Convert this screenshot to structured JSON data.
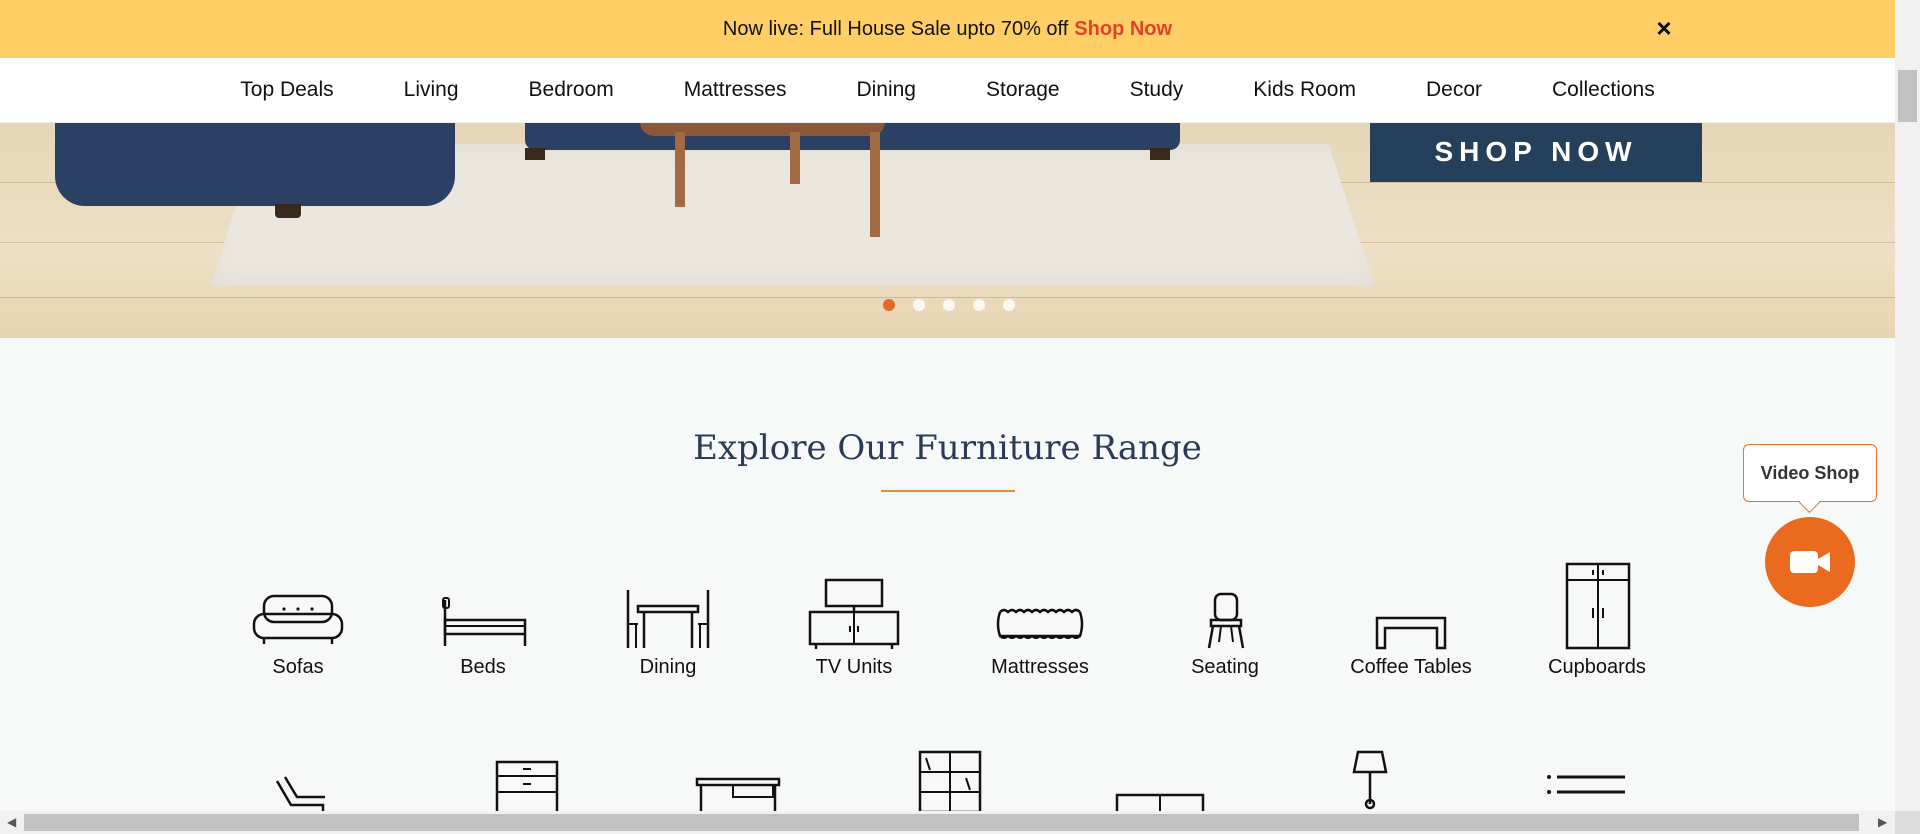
{
  "announcement": {
    "text": "Now live: Full House Sale upto 70% off",
    "link": "Shop Now",
    "close": "×"
  },
  "nav": {
    "items": [
      "Top Deals",
      "Living",
      "Bedroom",
      "Mattresses",
      "Dining",
      "Storage",
      "Study",
      "Kids Room",
      "Decor",
      "Collections"
    ]
  },
  "hero": {
    "cta": "SHOP NOW",
    "slides": 5,
    "active_slide": 1
  },
  "explore": {
    "title": "Explore Our Furniture Range",
    "categories": [
      {
        "label": "Sofas",
        "icon": "sofa-icon"
      },
      {
        "label": "Beds",
        "icon": "bed-icon"
      },
      {
        "label": "Dining",
        "icon": "dining-table-icon"
      },
      {
        "label": "TV Units",
        "icon": "tv-unit-icon"
      },
      {
        "label": "Mattresses",
        "icon": "mattress-icon"
      },
      {
        "label": "Seating",
        "icon": "chair-icon"
      },
      {
        "label": "Coffee Tables",
        "icon": "coffee-table-icon"
      },
      {
        "label": "Cupboards",
        "icon": "cupboard-icon"
      }
    ],
    "second_row_icons": [
      "recliner-icon",
      "chest-of-drawers-icon",
      "study-table-icon",
      "bookshelf-icon",
      "shoe-rack-icon",
      "floor-lamp-icon",
      "more-list-icon"
    ]
  },
  "video_shop": {
    "label": "Video Shop",
    "icon": "video-camera-icon"
  },
  "colors": {
    "announcement_bg": "#ffcf66",
    "accent": "#e0432a",
    "heading": "#2b3a55",
    "video_button": "#ea6a1f"
  }
}
